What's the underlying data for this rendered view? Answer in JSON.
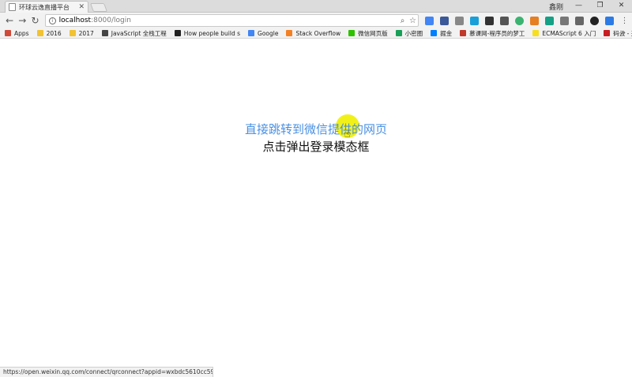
{
  "browser": {
    "tab_title": "环球云逸直播平台",
    "profile_name": "鑫刚",
    "url_host": "localhost",
    "url_path": ":8000/login"
  },
  "bookmarks": [
    {
      "label": "Apps",
      "color": "#d04a3a"
    },
    {
      "label": "2016",
      "color": "#f1c232"
    },
    {
      "label": "2017",
      "color": "#f1c232"
    },
    {
      "label": "JavaScript 全栈工程",
      "color": "#444444"
    },
    {
      "label": "How people build s",
      "color": "#222222"
    },
    {
      "label": "Google",
      "color": "#4285f4"
    },
    {
      "label": "Stack Overflow",
      "color": "#f48024"
    },
    {
      "label": "微信网页版",
      "color": "#2dc100"
    },
    {
      "label": "小密圈",
      "color": "#18a058"
    },
    {
      "label": "掘金",
      "color": "#007fff"
    },
    {
      "label": "慕课网-程序员的梦工",
      "color": "#c0392b"
    },
    {
      "label": "ECMAScript 6 入门",
      "color": "#f7df1e"
    },
    {
      "label": "码云 - 开源中国",
      "color": "#c71d23"
    }
  ],
  "page": {
    "wechat_link": "直接跳转到微信提供的网页",
    "login_text": "点击弹出登录模态框"
  },
  "status_url": "https://open.weixin.qq.com/connect/qrconnect?appid=wxbdc5610cc59c1631&r...",
  "colors": {
    "link": "#4a90e2",
    "cursor_highlight": "#f0f000"
  }
}
